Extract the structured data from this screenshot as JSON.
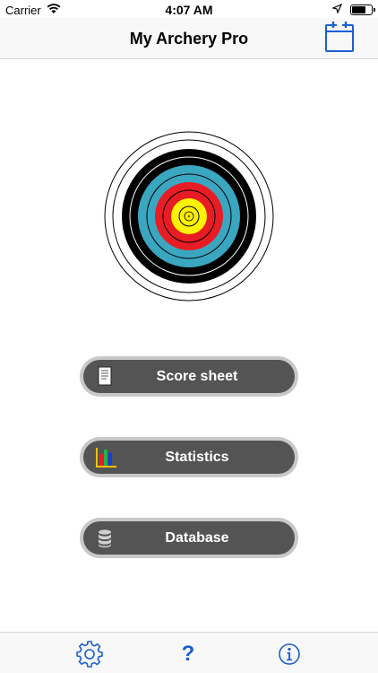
{
  "status_bar": {
    "carrier": "Carrier",
    "time": "4:07 AM"
  },
  "nav": {
    "title": "My Archery Pro",
    "calendar_icon": "calendar-icon"
  },
  "target": {
    "icon": "archery-target-icon",
    "ring_colors": [
      "#ffffff",
      "#000000",
      "#3aa6c0",
      "#e81c24",
      "#fff200"
    ]
  },
  "menu": {
    "items": [
      {
        "label": "Score sheet",
        "icon": "document-icon"
      },
      {
        "label": "Statistics",
        "icon": "bar-chart-icon"
      },
      {
        "label": "Database",
        "icon": "database-icon"
      }
    ]
  },
  "tab_bar": {
    "items": [
      {
        "name": "settings",
        "icon": "gear-icon"
      },
      {
        "name": "help",
        "icon": "question-mark-icon",
        "glyph": "?"
      },
      {
        "name": "info",
        "icon": "info-icon"
      }
    ]
  },
  "colors": {
    "accent": "#1a5fd0",
    "button_face": "#545454",
    "button_rim": "#c8c8c8",
    "bar_background": "#f8f8f8"
  }
}
